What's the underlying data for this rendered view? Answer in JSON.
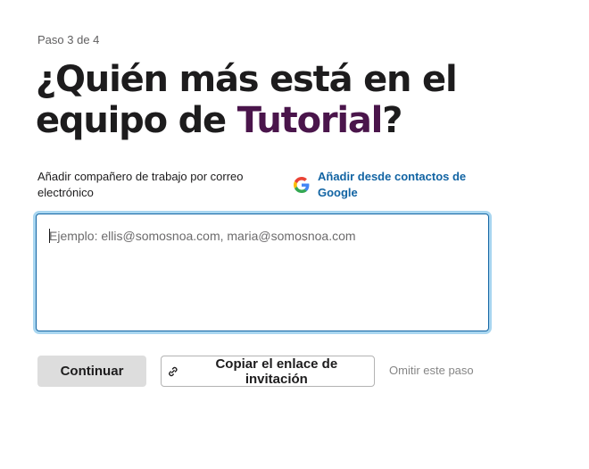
{
  "step_text": "Paso 3 de 4",
  "title": {
    "line1": "¿Quién más está en el",
    "line2_prefix": "equipo de ",
    "team_name": "Tutorial",
    "line2_suffix": "?"
  },
  "email_section": {
    "label": "Añadir compañero de trabajo por correo electrónico",
    "google_link": "Añadir desde contactos de Google",
    "placeholder": "Ejemplo: ellis@somosnoa.com, maria@somosnoa.com"
  },
  "actions": {
    "continue_label": "Continuar",
    "copy_link_label": "Copiar el enlace de invitación",
    "skip_label": "Omitir este paso"
  },
  "icons": {
    "google": "google-icon",
    "link": "link-icon"
  },
  "colors": {
    "accent": "#4a154b",
    "link": "#1264a3",
    "focus_ring": "#a9d6f0"
  }
}
